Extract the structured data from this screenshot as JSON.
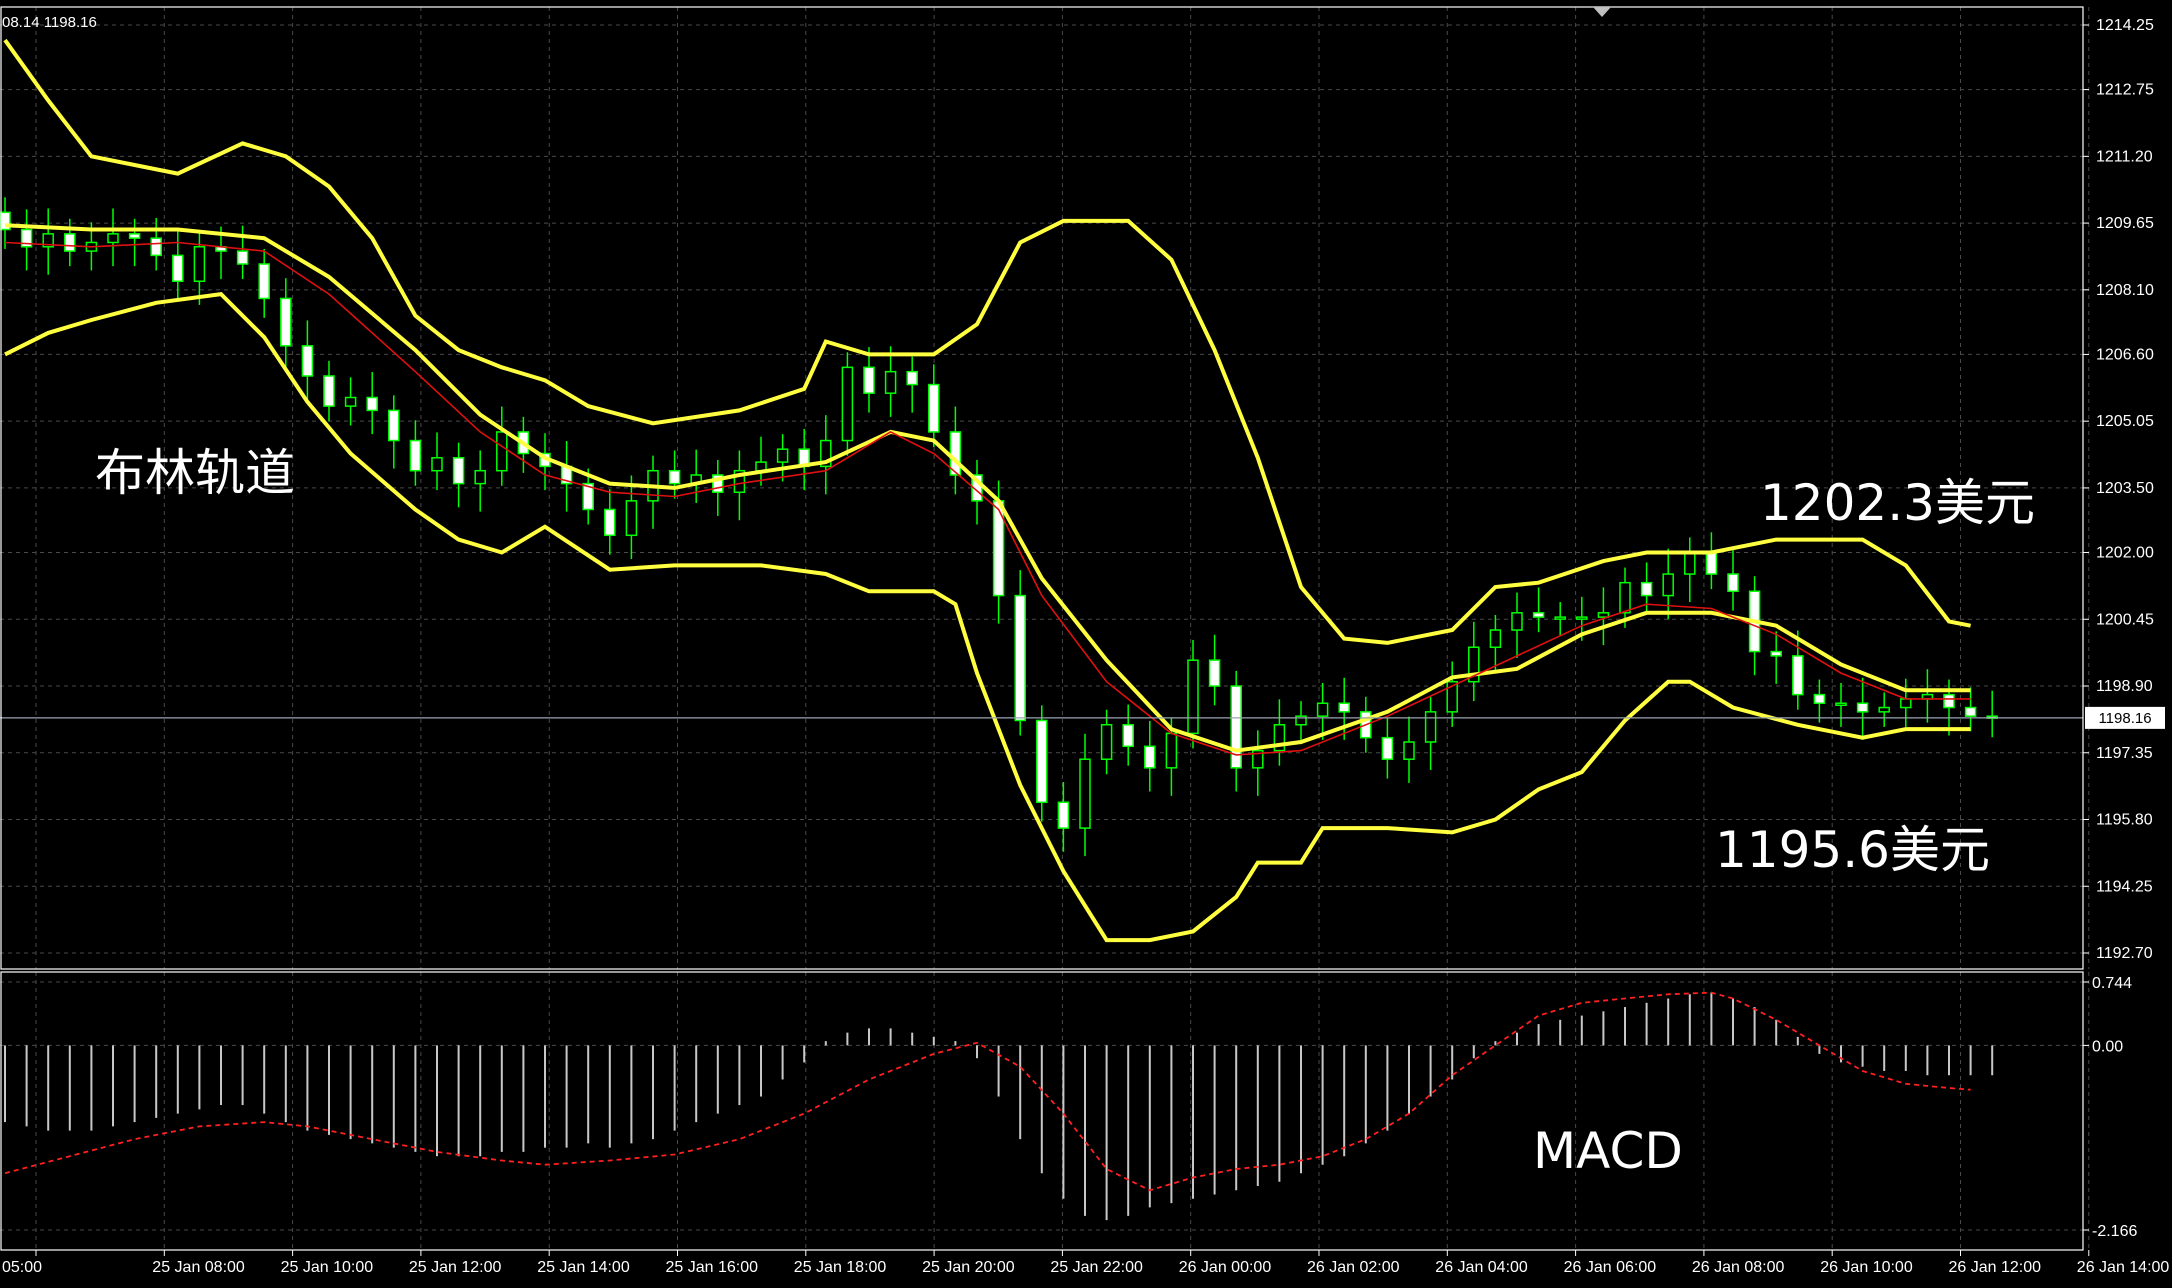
{
  "header": {
    "info": "08.14 1198.16"
  },
  "chart_data": [
    {
      "type": "candlestick",
      "title": "",
      "overlay_label": "布林轨道",
      "upper_band_annotation": "1202.3美元",
      "lower_band_annotation": "1195.6美元",
      "current_price": "1198.16",
      "ylim": [
        1192.7,
        1214.25
      ],
      "y_ticks": [
        "1214.25",
        "1212.75",
        "1211.20",
        "1209.65",
        "1208.10",
        "1206.60",
        "1205.05",
        "1203.50",
        "1202.00",
        "1200.45",
        "1198.90",
        "1197.35",
        "1195.80",
        "1194.25",
        "1192.70"
      ],
      "bollinger_upper": [
        [
          0,
          1213.9
        ],
        [
          2,
          1212.5
        ],
        [
          4,
          1211.2
        ],
        [
          6,
          1211.0
        ],
        [
          8,
          1210.8
        ],
        [
          11,
          1211.5
        ],
        [
          13,
          1211.2
        ],
        [
          15,
          1210.5
        ],
        [
          17,
          1209.3
        ],
        [
          19,
          1207.5
        ],
        [
          21,
          1206.7
        ],
        [
          23,
          1206.3
        ],
        [
          25,
          1206.0
        ],
        [
          27,
          1205.4
        ],
        [
          30,
          1205.0
        ],
        [
          34,
          1205.3
        ],
        [
          37,
          1205.8
        ],
        [
          38,
          1206.9
        ],
        [
          40,
          1206.6
        ],
        [
          43,
          1206.6
        ],
        [
          45,
          1207.3
        ],
        [
          47,
          1209.2
        ],
        [
          49,
          1209.7
        ],
        [
          52,
          1209.7
        ],
        [
          54,
          1208.8
        ],
        [
          56,
          1206.7
        ],
        [
          58,
          1204.2
        ],
        [
          60,
          1201.2
        ],
        [
          62,
          1200.0
        ],
        [
          64,
          1199.9
        ],
        [
          67,
          1200.2
        ],
        [
          69,
          1201.2
        ],
        [
          71,
          1201.3
        ],
        [
          74,
          1201.8
        ],
        [
          76,
          1202.0
        ],
        [
          79,
          1202.0
        ],
        [
          82,
          1202.3
        ],
        [
          86,
          1202.3
        ],
        [
          88,
          1201.7
        ],
        [
          90,
          1200.4
        ],
        [
          91,
          1200.3
        ]
      ],
      "bollinger_middle": [
        [
          0,
          1209.6
        ],
        [
          4,
          1209.5
        ],
        [
          8,
          1209.5
        ],
        [
          12,
          1209.3
        ],
        [
          15,
          1208.4
        ],
        [
          19,
          1206.7
        ],
        [
          22,
          1205.2
        ],
        [
          25,
          1204.2
        ],
        [
          28,
          1203.6
        ],
        [
          31,
          1203.5
        ],
        [
          34,
          1203.8
        ],
        [
          38,
          1204.1
        ],
        [
          41,
          1204.8
        ],
        [
          43,
          1204.6
        ],
        [
          46,
          1203.2
        ],
        [
          48,
          1201.4
        ],
        [
          51,
          1199.5
        ],
        [
          54,
          1197.9
        ],
        [
          57,
          1197.4
        ],
        [
          60,
          1197.6
        ],
        [
          64,
          1198.3
        ],
        [
          67,
          1199.1
        ],
        [
          70,
          1199.3
        ],
        [
          73,
          1200.1
        ],
        [
          76,
          1200.6
        ],
        [
          79,
          1200.6
        ],
        [
          82,
          1200.3
        ],
        [
          85,
          1199.4
        ],
        [
          88,
          1198.8
        ],
        [
          91,
          1198.8
        ]
      ],
      "bollinger_lower": [
        [
          0,
          1206.6
        ],
        [
          2,
          1207.1
        ],
        [
          4,
          1207.4
        ],
        [
          7,
          1207.8
        ],
        [
          10,
          1208.0
        ],
        [
          12,
          1207.0
        ],
        [
          14,
          1205.5
        ],
        [
          16,
          1204.3
        ],
        [
          19,
          1203.0
        ],
        [
          21,
          1202.3
        ],
        [
          23,
          1202.0
        ],
        [
          25,
          1202.6
        ],
        [
          28,
          1201.6
        ],
        [
          31,
          1201.7
        ],
        [
          35,
          1201.7
        ],
        [
          38,
          1201.5
        ],
        [
          40,
          1201.1
        ],
        [
          43,
          1201.1
        ],
        [
          44,
          1200.8
        ],
        [
          45,
          1199.2
        ],
        [
          47,
          1196.6
        ],
        [
          49,
          1194.6
        ],
        [
          51,
          1193.0
        ],
        [
          53,
          1193.0
        ],
        [
          55,
          1193.2
        ],
        [
          57,
          1194.0
        ],
        [
          58,
          1194.8
        ],
        [
          60,
          1194.8
        ],
        [
          61,
          1195.6
        ],
        [
          64,
          1195.6
        ],
        [
          67,
          1195.5
        ],
        [
          69,
          1195.8
        ],
        [
          71,
          1196.5
        ],
        [
          73,
          1196.9
        ],
        [
          75,
          1198.1
        ],
        [
          77,
          1199.0
        ],
        [
          78,
          1199.0
        ],
        [
          80,
          1198.4
        ],
        [
          83,
          1198.0
        ],
        [
          86,
          1197.7
        ],
        [
          88,
          1197.9
        ],
        [
          91,
          1197.9
        ]
      ],
      "moving_average": [
        [
          0,
          1209.2
        ],
        [
          4,
          1209.1
        ],
        [
          8,
          1209.2
        ],
        [
          12,
          1209.0
        ],
        [
          15,
          1208.0
        ],
        [
          19,
          1206.2
        ],
        [
          22,
          1204.8
        ],
        [
          25,
          1203.8
        ],
        [
          28,
          1203.4
        ],
        [
          31,
          1203.3
        ],
        [
          34,
          1203.6
        ],
        [
          38,
          1203.9
        ],
        [
          41,
          1204.8
        ],
        [
          43,
          1204.3
        ],
        [
          46,
          1203.0
        ],
        [
          48,
          1201.0
        ],
        [
          51,
          1199.0
        ],
        [
          54,
          1197.8
        ],
        [
          57,
          1197.3
        ],
        [
          60,
          1197.4
        ],
        [
          64,
          1198.2
        ],
        [
          67,
          1198.9
        ],
        [
          70,
          1199.6
        ],
        [
          73,
          1200.3
        ],
        [
          76,
          1200.8
        ],
        [
          79,
          1200.7
        ],
        [
          82,
          1200.1
        ],
        [
          85,
          1199.2
        ],
        [
          88,
          1198.6
        ],
        [
          91,
          1198.6
        ]
      ],
      "close_series": [
        1209.5,
        1209.1,
        1209.4,
        1209.0,
        1209.2,
        1209.4,
        1209.3,
        1208.9,
        1208.3,
        1209.1,
        1209.0,
        1208.7,
        1207.9,
        1206.8,
        1206.1,
        1205.4,
        1205.6,
        1205.3,
        1204.6,
        1203.9,
        1204.2,
        1203.6,
        1203.9,
        1204.8,
        1204.3,
        1204.0,
        1203.6,
        1203.0,
        1202.4,
        1203.2,
        1203.9,
        1203.6,
        1203.8,
        1203.4,
        1203.9,
        1204.1,
        1204.4,
        1204.0,
        1204.6,
        1206.3,
        1205.7,
        1206.2,
        1205.9,
        1204.8,
        1203.8,
        1203.2,
        1201.0,
        1198.1,
        1196.2,
        1195.6,
        1197.2,
        1198.0,
        1197.5,
        1197.0,
        1197.8,
        1199.5,
        1198.9,
        1197.0,
        1197.4,
        1198.0,
        1198.2,
        1198.5,
        1198.3,
        1197.7,
        1197.2,
        1197.6,
        1198.3,
        1199.0,
        1199.8,
        1200.2,
        1200.6,
        1200.5,
        1200.5,
        1200.5,
        1200.6,
        1201.3,
        1201.0,
        1201.5,
        1202.0,
        1201.5,
        1201.1,
        1199.7,
        1199.6,
        1198.7,
        1198.5,
        1198.5,
        1198.3,
        1198.4,
        1198.6,
        1198.7,
        1198.4,
        1198.2,
        1198.16
      ]
    },
    {
      "type": "bar",
      "title": "",
      "overlay_label": "MACD",
      "ylim": [
        -2.166,
        0.744
      ],
      "y_ticks": [
        "0.744",
        "0.00",
        "-2.166"
      ],
      "histogram": [
        -0.9,
        -0.95,
        -1.0,
        -1.0,
        -1.0,
        -0.95,
        -0.9,
        -0.85,
        -0.8,
        -0.75,
        -0.7,
        -0.7,
        -0.8,
        -0.9,
        -1.0,
        -1.05,
        -1.1,
        -1.15,
        -1.2,
        -1.25,
        -1.3,
        -1.3,
        -1.3,
        -1.25,
        -1.25,
        -1.2,
        -1.2,
        -1.15,
        -1.2,
        -1.15,
        -1.1,
        -1.0,
        -0.9,
        -0.8,
        -0.7,
        -0.6,
        -0.4,
        -0.2,
        0.05,
        0.15,
        0.2,
        0.2,
        0.15,
        0.1,
        0.05,
        -0.15,
        -0.6,
        -1.1,
        -1.5,
        -1.8,
        -2.0,
        -2.05,
        -2.0,
        -1.9,
        -1.85,
        -1.8,
        -1.75,
        -1.7,
        -1.65,
        -1.6,
        -1.5,
        -1.4,
        -1.3,
        -1.15,
        -1.0,
        -0.8,
        -0.6,
        -0.4,
        -0.15,
        0.05,
        0.15,
        0.25,
        0.3,
        0.35,
        0.4,
        0.45,
        0.5,
        0.55,
        0.6,
        0.62,
        0.55,
        0.45,
        0.3,
        0.1,
        -0.1,
        -0.2,
        -0.25,
        -0.3,
        -0.3,
        -0.35,
        -0.35,
        -0.35,
        -0.35
      ],
      "signal": [
        [
          0,
          -1.5
        ],
        [
          3,
          -1.3
        ],
        [
          6,
          -1.1
        ],
        [
          9,
          -0.95
        ],
        [
          12,
          -0.9
        ],
        [
          14,
          -0.95
        ],
        [
          17,
          -1.1
        ],
        [
          20,
          -1.25
        ],
        [
          23,
          -1.35
        ],
        [
          25,
          -1.4
        ],
        [
          28,
          -1.35
        ],
        [
          31,
          -1.28
        ],
        [
          34,
          -1.1
        ],
        [
          37,
          -0.8
        ],
        [
          40,
          -0.4
        ],
        [
          43,
          -0.1
        ],
        [
          45,
          0.03
        ],
        [
          47,
          -0.25
        ],
        [
          49,
          -0.8
        ],
        [
          51,
          -1.45
        ],
        [
          53,
          -1.7
        ],
        [
          55,
          -1.55
        ],
        [
          57,
          -1.45
        ],
        [
          59,
          -1.4
        ],
        [
          61,
          -1.3
        ],
        [
          63,
          -1.1
        ],
        [
          65,
          -0.8
        ],
        [
          67,
          -0.35
        ],
        [
          69,
          0.0
        ],
        [
          71,
          0.35
        ],
        [
          73,
          0.5
        ],
        [
          75,
          0.55
        ],
        [
          77,
          0.6
        ],
        [
          79,
          0.62
        ],
        [
          80,
          0.55
        ],
        [
          82,
          0.3
        ],
        [
          84,
          0.0
        ],
        [
          86,
          -0.3
        ],
        [
          88,
          -0.45
        ],
        [
          90,
          -0.5
        ],
        [
          91,
          -0.52
        ]
      ]
    }
  ],
  "x_axis": {
    "labels": [
      "05:00",
      "25 Jan 08:00",
      "25 Jan 10:00",
      "25 Jan 12:00",
      "25 Jan 14:00",
      "25 Jan 16:00",
      "25 Jan 18:00",
      "25 Jan 20:00",
      "25 Jan 22:00",
      "26 Jan 00:00",
      "26 Jan 02:00",
      "26 Jan 04:00",
      "26 Jan 06:00",
      "26 Jan 08:00",
      "26 Jan 10:00",
      "26 Jan 12:00",
      "26 Jan 14:00"
    ]
  },
  "colors": {
    "background": "#000000",
    "grid": "#4a4a4a",
    "bands": "#ffff40",
    "ma": "#e01010",
    "candle": "#00ff00",
    "candle_body_up": "#000000",
    "candle_body_down": "#ffffff",
    "histogram": "#c8c8c8",
    "signal": "#ff2020",
    "axis_text": "#ffffff"
  }
}
